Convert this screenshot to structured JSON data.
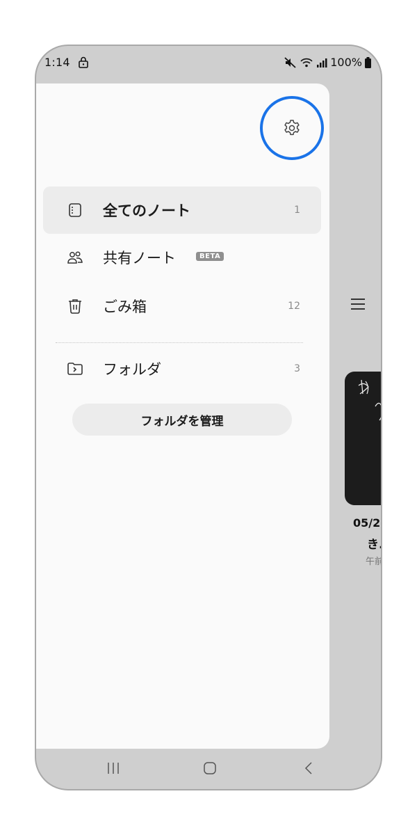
{
  "status_bar": {
    "time": "1:14",
    "battery": "100%"
  },
  "drawer": {
    "items": [
      {
        "label": "全てのノート",
        "count": "1",
        "icon": "notebook-icon"
      },
      {
        "label": "共有ノート",
        "badge": "BETA",
        "icon": "shared-people-icon"
      },
      {
        "label": "ごみ箱",
        "count": "12",
        "icon": "trash-icon"
      },
      {
        "label": "フォルダ",
        "count": "3",
        "icon": "folder-icon"
      }
    ],
    "manage_folders_label": "フォルダを管理"
  },
  "background_note": {
    "title": "05/2",
    "snippet": "き.",
    "time": "午前"
  },
  "colors": {
    "accent_ring": "#1a73e8",
    "drawer_bg": "#fafafa",
    "active_item_bg": "#ececec",
    "note_card_bg": "#1c1c1c"
  }
}
